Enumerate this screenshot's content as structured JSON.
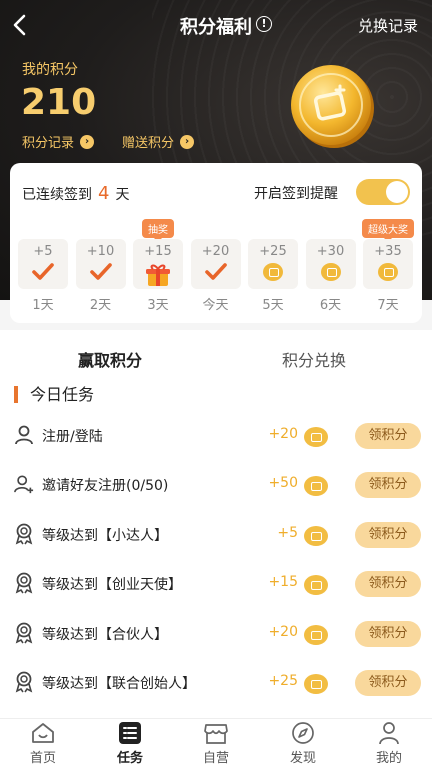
{
  "header": {
    "title": "积分福利",
    "right_link": "兑换记录",
    "points_label": "我的积分",
    "points_value": "210",
    "link_records": "积分记录",
    "link_gift": "赠送积分"
  },
  "sign_in": {
    "streak_prefix": "已连续签到",
    "streak_days": "4",
    "streak_suffix": "天",
    "reminder_label": "开启签到提醒",
    "reminder_on": true,
    "days": [
      {
        "points": "+5",
        "label": "1天",
        "state": "checked",
        "tag": ""
      },
      {
        "points": "+10",
        "label": "2天",
        "state": "checked",
        "tag": ""
      },
      {
        "points": "+15",
        "label": "3天",
        "state": "gift",
        "tag": "抽奖"
      },
      {
        "points": "+20",
        "label": "今天",
        "state": "checked",
        "tag": ""
      },
      {
        "points": "+25",
        "label": "5天",
        "state": "coin",
        "tag": ""
      },
      {
        "points": "+30",
        "label": "6天",
        "state": "coin",
        "tag": ""
      },
      {
        "points": "+35",
        "label": "7天",
        "state": "coin",
        "tag": "超级大奖"
      }
    ]
  },
  "tabs": {
    "earn": "赢取积分",
    "exchange": "积分兑换"
  },
  "tasks_section": {
    "title": "今日任务",
    "items": [
      {
        "name": "注册/登陆",
        "points": "+20",
        "button": "领积分",
        "icon": "user-icon"
      },
      {
        "name": "邀请好友注册(0/50)",
        "points": "+50",
        "button": "领积分",
        "icon": "add-user-icon"
      },
      {
        "name": "等级达到【小达人】",
        "points": "+5",
        "button": "领积分",
        "icon": "medal-icon"
      },
      {
        "name": "等级达到【创业天使】",
        "points": "+15",
        "button": "领积分",
        "icon": "medal-icon"
      },
      {
        "name": "等级达到【合伙人】",
        "points": "+20",
        "button": "领积分",
        "icon": "medal-icon"
      },
      {
        "name": "等级达到【联合创始人】",
        "points": "+25",
        "button": "领积分",
        "icon": "medal-icon"
      }
    ]
  },
  "tabbar": {
    "items": [
      {
        "label": "首页",
        "icon": "home-icon"
      },
      {
        "label": "任务",
        "icon": "task-list-icon",
        "active": true
      },
      {
        "label": "自营",
        "icon": "store-icon"
      },
      {
        "label": "发现",
        "icon": "compass-icon"
      },
      {
        "label": "我的",
        "icon": "profile-icon"
      }
    ]
  },
  "colors": {
    "accent": "#f2bd42",
    "orange": "#e86a2a",
    "hero_bg": "#1f1d1c",
    "button_bg": "#f9d89c"
  }
}
